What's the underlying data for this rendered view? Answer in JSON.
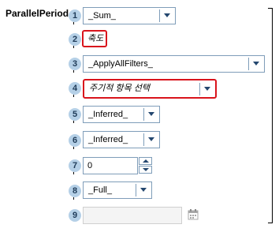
{
  "function_name": "ParallelPeriod",
  "params": [
    {
      "number": "1",
      "value": "_Sum_"
    },
    {
      "number": "2",
      "value": "축도"
    },
    {
      "number": "3",
      "value": "_ApplyAllFilters_"
    },
    {
      "number": "4",
      "value": "주기적 항목 선택"
    },
    {
      "number": "5",
      "value": "_Inferred_"
    },
    {
      "number": "6",
      "value": "_Inferred_"
    },
    {
      "number": "7",
      "value": "0"
    },
    {
      "number": "8",
      "value": "_Full_"
    },
    {
      "number": "9",
      "value": ""
    }
  ],
  "icons": {
    "dropdown": "chevron-down-icon",
    "spin_up": "caret-up-icon",
    "spin_down": "caret-down-icon",
    "calendar": "calendar-icon"
  },
  "colors": {
    "badge_fill": "#b5d0e7",
    "highlight_border": "#d9141c",
    "input_border": "#7f9db9",
    "arrow": "#24476f"
  }
}
